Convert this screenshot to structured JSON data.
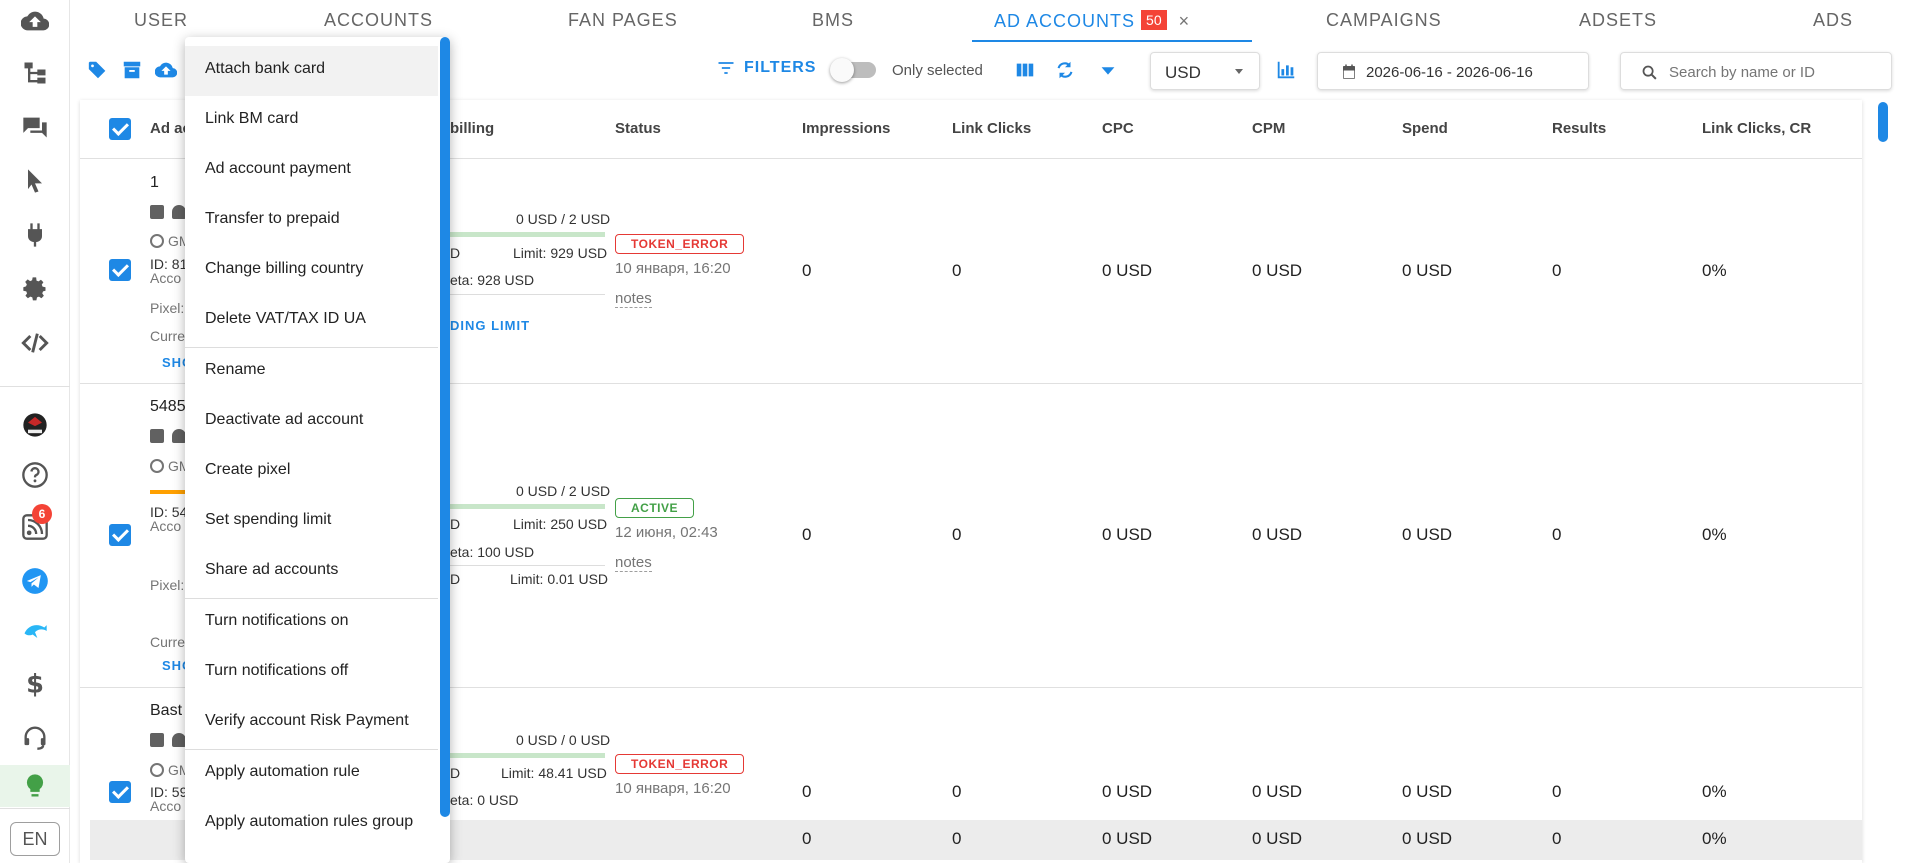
{
  "sidebar": {
    "icons": [
      "cloud-upload-icon",
      "hierarchy-icon",
      "chat-icon",
      "cursor-icon",
      "plug-icon",
      "gear-icon",
      "code-icon",
      "avatar",
      "help-icon",
      "rss-icon",
      "telegram-icon",
      "dolphin-icon",
      "dollar-icon",
      "headset-icon",
      "lightbulb-icon"
    ],
    "rss_badge": "6",
    "language": "EN"
  },
  "tabs": [
    {
      "label": "USER"
    },
    {
      "label": "ACCOUNTS"
    },
    {
      "label": "FAN PAGES"
    },
    {
      "label": "BMS"
    },
    {
      "label": "AD ACCOUNTS",
      "count": "50",
      "active": true
    },
    {
      "label": "CAMPAIGNS"
    },
    {
      "label": "ADSETS"
    },
    {
      "label": "ADS"
    }
  ],
  "tab_close": "×",
  "toolbar": {
    "filters_label": "FILTERS",
    "only_selected_label": "Only selected",
    "only_selected_on": false,
    "currency": "USD",
    "date_range": "2026-06-16 - 2026-06-16",
    "search_placeholder": "Search by name or ID"
  },
  "table": {
    "headers": {
      "ad_account": "Ad ac",
      "billing": "billing",
      "status": "Status",
      "impressions": "Impressions",
      "link_clicks": "Link Clicks",
      "cpc": "CPC",
      "cpm": "CPM",
      "spend": "Spend",
      "results": "Results",
      "link_clicks_cr": "Link Clicks, CR"
    },
    "rows": [
      {
        "name": "1",
        "tz": "GM",
        "id": "ID: 81",
        "acc": "Acco",
        "pixel": "Pixel:",
        "currency": "Curre",
        "show": "SHO",
        "billing_spent": "0 USD / 2 USD",
        "billing_d": "D",
        "limit": "Limit: 929 USD",
        "meta": "eta: 928 USD",
        "spending_limit_link": "DING LIMIT",
        "status": "TOKEN_ERROR",
        "status_type": "error",
        "date": "10 января, 16:20",
        "notes": "notes",
        "impressions": "0",
        "link_clicks": "0",
        "cpc": "0 USD",
        "cpm": "0 USD",
        "spend": "0 USD",
        "results": "0",
        "cr": "0%"
      },
      {
        "name": "5485",
        "tz": "GM",
        "id": "ID: 54",
        "acc": "Acco",
        "pixel": "Pixel:",
        "currency": "Curre",
        "show": "SHO",
        "billing_spent": "0 USD / 2 USD",
        "billing_d": "D",
        "limit": "Limit: 250 USD",
        "meta": "eta: 100 USD",
        "billing_d2": "D",
        "limit2": "Limit: 0.01 USD",
        "status": "ACTIVE",
        "status_type": "ok",
        "date": "12 июня, 02:43",
        "notes": "notes",
        "impressions": "0",
        "link_clicks": "0",
        "cpc": "0 USD",
        "cpm": "0 USD",
        "spend": "0 USD",
        "results": "0",
        "cr": "0%"
      },
      {
        "name": "Bast",
        "tz": "GM",
        "id": "ID: 59",
        "acc": "Acco",
        "billing_spent": "0 USD / 0 USD",
        "billing_d": "D",
        "limit": "Limit: 48.41 USD",
        "meta": "eta: 0 USD",
        "status": "TOKEN_ERROR",
        "status_type": "error",
        "date": "10 января, 16:20",
        "notes": "notes",
        "impressions": "0",
        "link_clicks": "0",
        "cpc": "0 USD",
        "cpm": "0 USD",
        "spend": "0 USD",
        "results": "0",
        "cr": "0%"
      }
    ],
    "totals": {
      "impressions": "0",
      "link_clicks": "0",
      "cpc": "0 USD",
      "cpm": "0 USD",
      "spend": "0 USD",
      "results": "0",
      "cr": "0%"
    }
  },
  "menu": {
    "items": [
      "Attach bank card",
      "Link BM card",
      "Ad account payment",
      "Transfer to prepaid",
      "Change billing country",
      "Delete VAT/TAX ID UA",
      "Rename",
      "Deactivate ad account",
      "Create pixel",
      "Set spending limit",
      "Share ad accounts",
      "Turn notifications on",
      "Turn notifications off",
      "Verify account Risk Payment",
      "Apply automation rule",
      "Apply automation rules group"
    ]
  },
  "colors": {
    "accent": "#1e88e5",
    "error": "#e53935",
    "ok": "#43a047",
    "badge": "#f44336"
  }
}
